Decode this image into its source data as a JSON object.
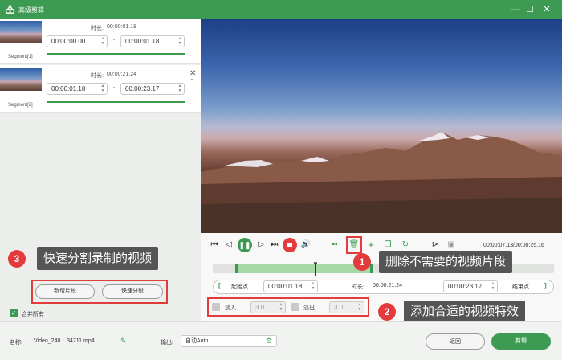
{
  "window": {
    "title": "高级剪辑",
    "minimize": "—",
    "maximize": "☐",
    "close": "✕"
  },
  "segments": [
    {
      "label": "Segment[1]",
      "duration_label": "时长:",
      "duration": "00:00:01.18",
      "start": "00:00:00.00",
      "end": "00:00:01.18",
      "sep": "-",
      "progress": 1.0
    },
    {
      "label": "Segment[2]",
      "duration_label": "时长:",
      "duration": "00:00:21.24",
      "start": "00:00:01.18",
      "end": "00:00:23.17",
      "sep": "-",
      "progress": 1.0
    }
  ],
  "left_buttons": {
    "new_segment": "新增片段",
    "quick_split": "快速分段"
  },
  "merge_all": {
    "label": "合并所有",
    "checked": true
  },
  "player": {
    "time": "00:00:07.13/00:00:25.16"
  },
  "timeline": {
    "start_label": "起始点",
    "start_value": "00:00:01.18",
    "duration_label": "时长:",
    "duration_value": "00:00:21.24",
    "end_value": "00:00:23.17",
    "end_label": "结束点",
    "bracket_left": "[",
    "bracket_right": "]"
  },
  "effects": {
    "fade_in_label": "淡入",
    "fade_in_value": "3.0",
    "fade_out_label": "淡出",
    "fade_out_value": "3.0"
  },
  "callouts": [
    {
      "num": "1",
      "text": "删除不需要的视频片段"
    },
    {
      "num": "2",
      "text": "添加合适的视频特效"
    },
    {
      "num": "3",
      "text": "快速分割录制的视频"
    }
  ],
  "bottom": {
    "name_label": "名称:",
    "name_value": "Video_240....34711.mp4",
    "output_label": "输出:",
    "output_value": "自动Auto",
    "back": "返回",
    "cut": "剪辑"
  },
  "colors": {
    "accent": "#3d9a52",
    "callout_red": "#e33b3b"
  }
}
